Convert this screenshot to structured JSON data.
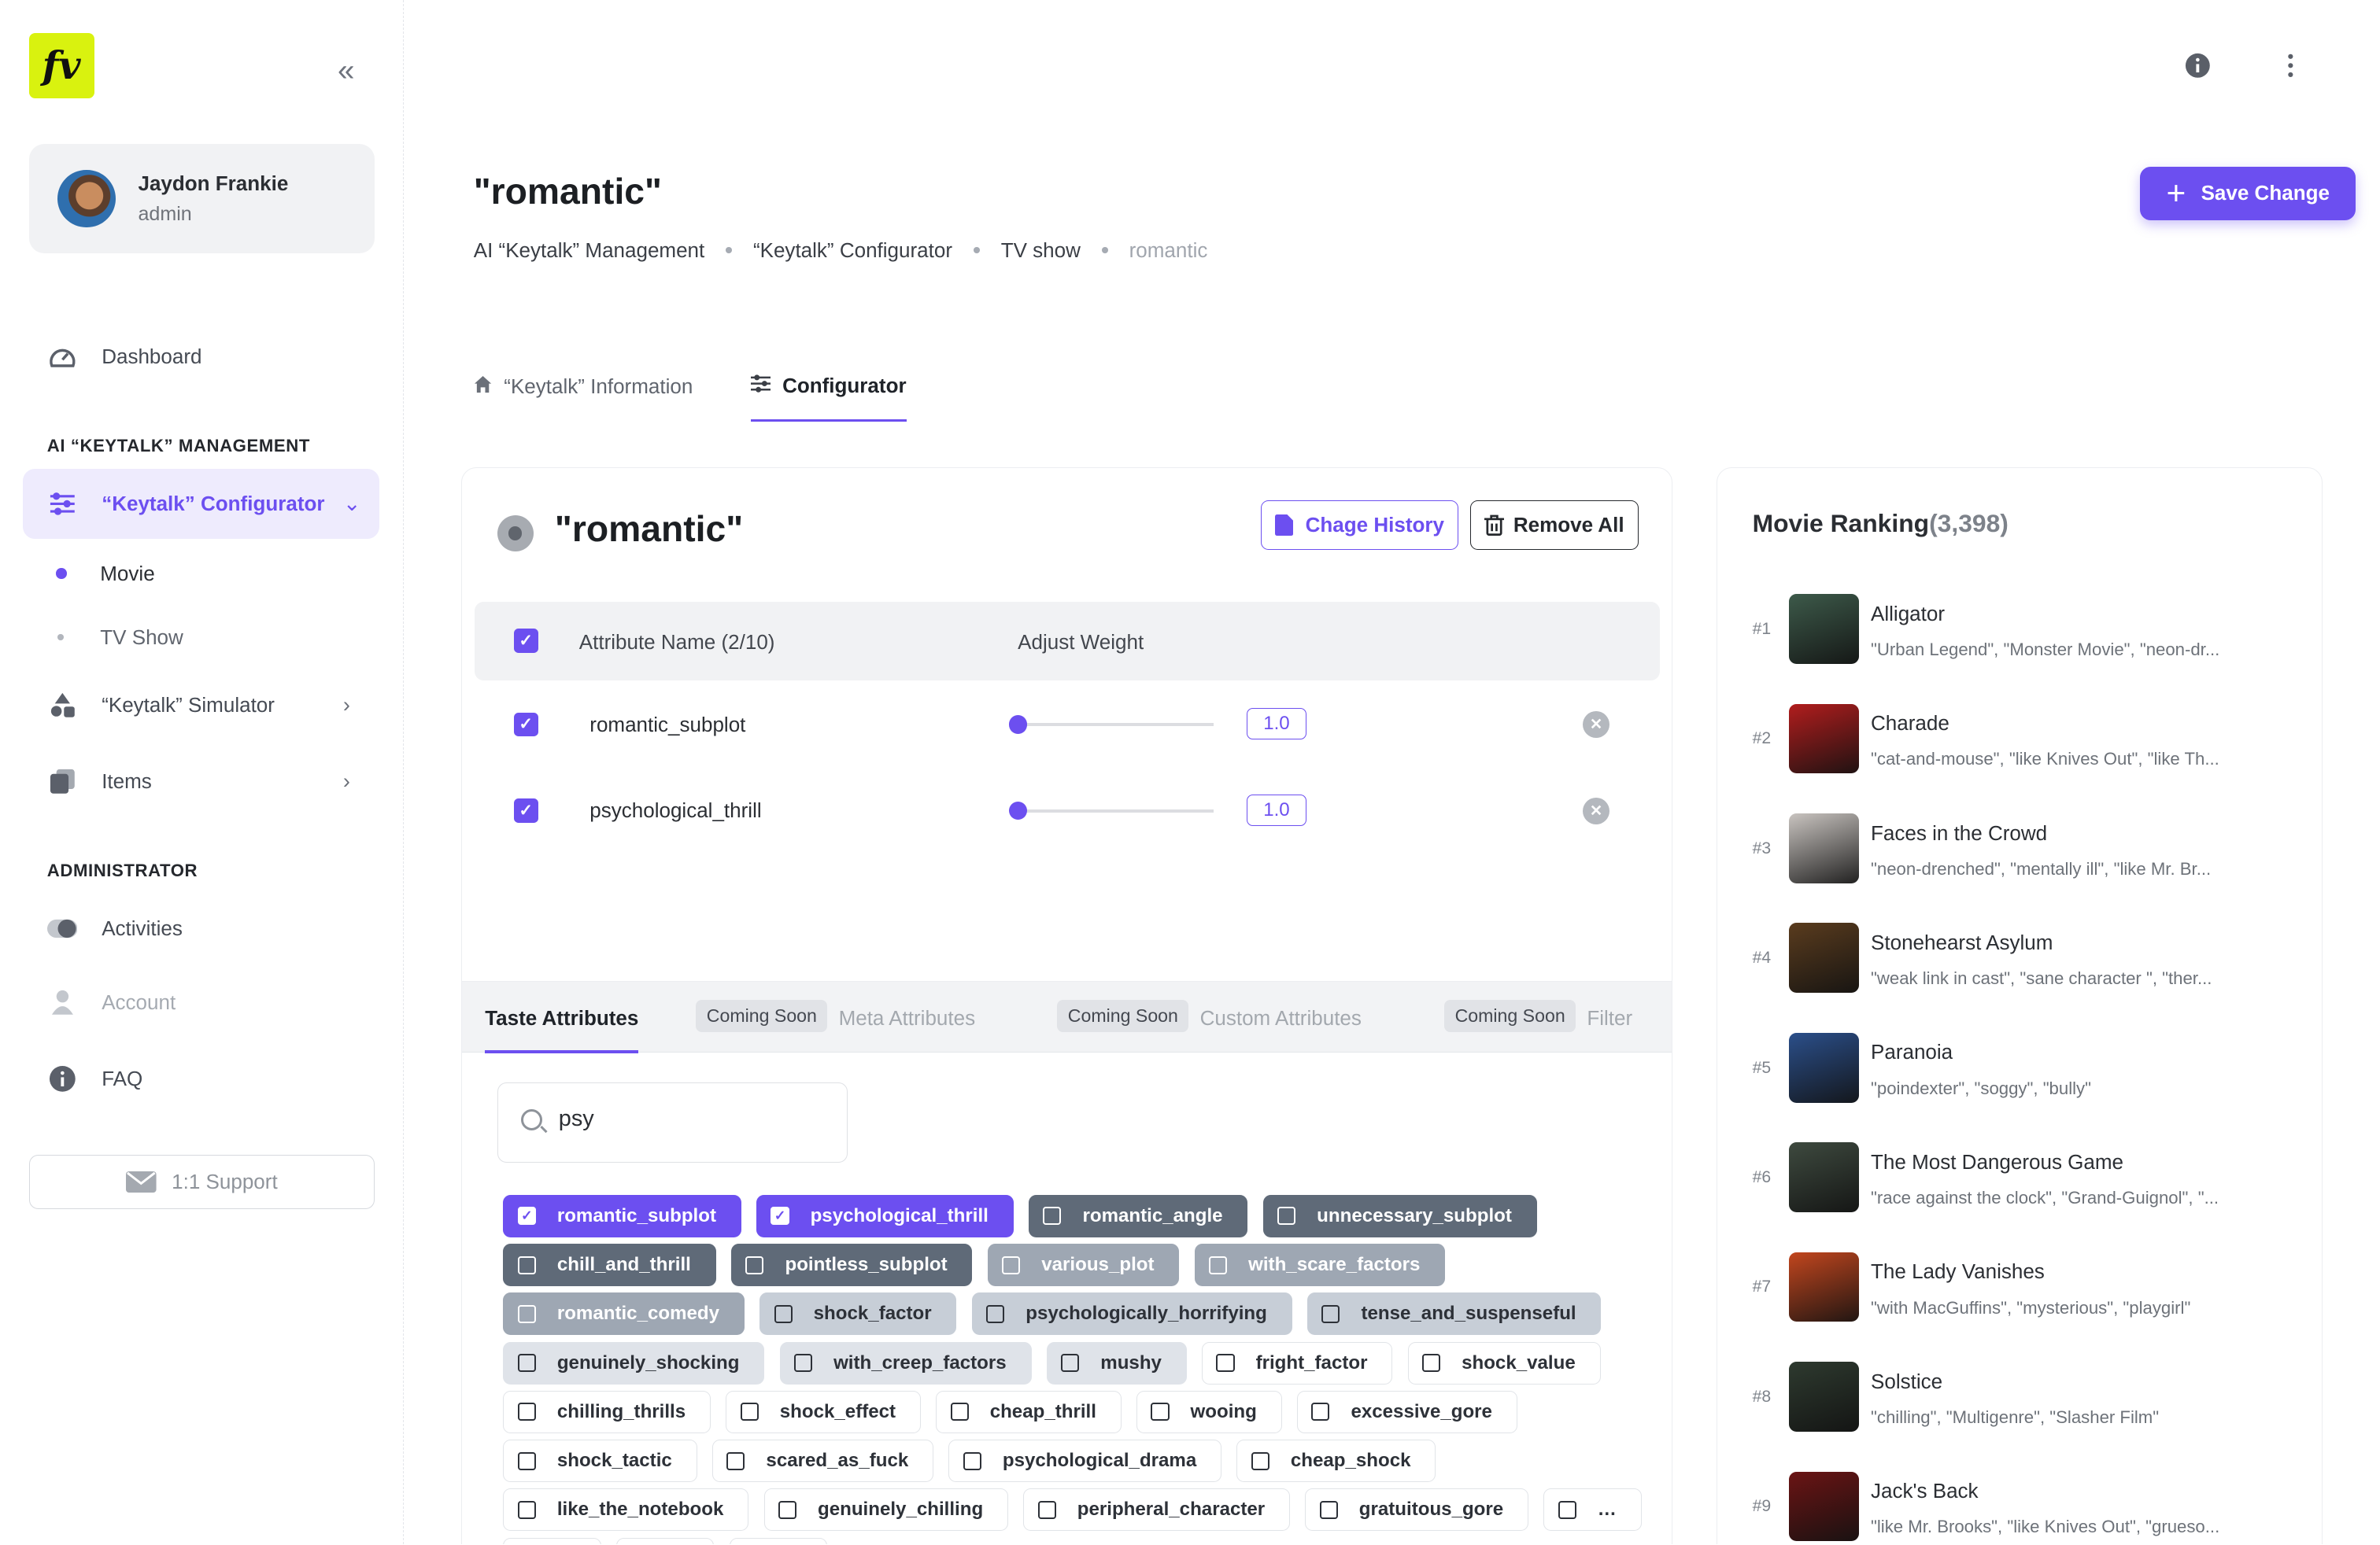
{
  "sidebar": {
    "logo": "fv",
    "user": {
      "name": "Jaydon Frankie",
      "role": "admin"
    },
    "dashboard": "Dashboard",
    "section_ai": "AI “KEYTALK” MANAGEMENT",
    "configurator": "“Keytalk” Configurator",
    "sub_movie": "Movie",
    "sub_tvshow": "TV Show",
    "simulator": "“Keytalk” Simulator",
    "items": "Items",
    "section_admin": "ADMINISTRATOR",
    "activities": "Activities",
    "account": "Account",
    "faq": "FAQ",
    "support": "1:1 Support"
  },
  "header": {
    "title": "\"romantic\"",
    "breadcrumbs": [
      "AI “Keytalk” Management",
      "“Keytalk” Configurator",
      "TV show",
      "romantic"
    ],
    "save_label": "Save Change"
  },
  "tabs": {
    "info": "“Keytalk” Information",
    "configurator": "Configurator"
  },
  "card": {
    "title": "\"romantic\"",
    "history_btn": "Chage History",
    "remove_btn": "Remove All",
    "col_name": "Attribute Name (2/10)",
    "col_weight": "Adjust Weight",
    "rows": [
      {
        "name": "romantic_subplot",
        "weight": "1.0",
        "checked": true
      },
      {
        "name": "psychological_thrill",
        "weight": "1.0",
        "checked": true
      }
    ],
    "subtabs": {
      "taste": "Taste Attributes",
      "coming": "Coming Soon",
      "meta": "Meta Attributes",
      "custom": "Custom Attributes",
      "filter": "Filter"
    },
    "search": {
      "value": "psy",
      "placeholder": ""
    },
    "chips": [
      [
        "romantic_subplot",
        "sel"
      ],
      [
        "psychological_thrill",
        "sel"
      ],
      [
        "romantic_angle",
        "d"
      ],
      [
        "unnecessary_subplot",
        "d"
      ],
      [
        "chill_and_thrill",
        "d"
      ],
      [
        "pointless_subplot",
        "d"
      ],
      [
        "various_plot",
        "m"
      ],
      [
        "with_scare_factors",
        "m"
      ],
      [
        "romantic_comedy",
        "m"
      ],
      [
        "shock_factor",
        "l"
      ],
      [
        "psychologically_horrifying",
        "l"
      ],
      [
        "tense_and_suspenseful",
        "l"
      ],
      [
        "genuinely_shocking",
        "xl"
      ],
      [
        "with_creep_factors",
        "xl"
      ],
      [
        "mushy",
        "xl"
      ],
      [
        "fright_factor",
        "w"
      ],
      [
        "shock_value",
        "w"
      ],
      [
        "chilling_thrills",
        "w"
      ],
      [
        "shock_effect",
        "w"
      ],
      [
        "cheap_thrill",
        "w"
      ],
      [
        "wooing",
        "w"
      ],
      [
        "excessive_gore",
        "w"
      ],
      [
        "shock_tactic",
        "w"
      ],
      [
        "scared_as_fuck",
        "w"
      ],
      [
        "psychological_drama",
        "w"
      ],
      [
        "cheap_shock",
        "w"
      ],
      [
        "like_the_notebook",
        "w"
      ],
      [
        "genuinely_chilling",
        "w"
      ],
      [
        "peripheral_character",
        "w"
      ],
      [
        "gratuitous_gore",
        "w"
      ],
      [
        "…",
        "w"
      ],
      [
        "…",
        "w"
      ],
      [
        "…",
        "w"
      ],
      [
        "…",
        "w"
      ]
    ]
  },
  "ranking": {
    "title": "Movie Ranking",
    "count": "(3,398)",
    "items": [
      {
        "rank": "#1",
        "name": "Alligator",
        "tags": "\"Urban Legend\", \"Monster Movie\", \"neon-dr...",
        "color": "#3d5a4a"
      },
      {
        "rank": "#2",
        "name": "Charade",
        "tags": "\"cat-and-mouse\", \"like Knives Out\", \"like Th...",
        "color": "#b11d1d"
      },
      {
        "rank": "#3",
        "name": "Faces in the Crowd",
        "tags": "\"neon-drenched\", \"mentally ill\", \"like Mr. Br...",
        "color": "#c9c4c0"
      },
      {
        "rank": "#4",
        "name": "Stonehearst Asylum",
        "tags": "\"weak link in cast\", \"sane character \", \"ther...",
        "color": "#5a3c1e"
      },
      {
        "rank": "#5",
        "name": "Paranoia",
        "tags": "\"poindexter\", \"soggy\", \"bully\"",
        "color": "#2b4f8a"
      },
      {
        "rank": "#6",
        "name": "The Most Dangerous Game",
        "tags": "\"race against the clock\", \"Grand-Guignol\", \"...",
        "color": "#3e4a3f"
      },
      {
        "rank": "#7",
        "name": "The Lady Vanishes",
        "tags": "\"with MacGuffins\", \"mysterious\", \"playgirl\"",
        "color": "#c2461e"
      },
      {
        "rank": "#8",
        "name": "Solstice",
        "tags": "\"chilling\", \"Multigenre\", \"Slasher Film\"",
        "color": "#2e3a2f"
      },
      {
        "rank": "#9",
        "name": "Jack's Back",
        "tags": "\"like Mr. Brooks\", \"like Knives Out\", \"grueso...",
        "color": "#6b1414"
      }
    ]
  },
  "colors": {
    "accent": "#6c4ff0",
    "logo_bg": "#d9f20f"
  }
}
